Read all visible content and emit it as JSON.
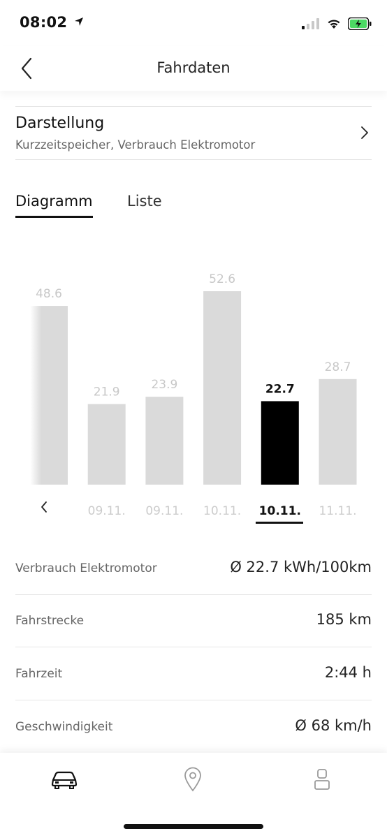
{
  "status_bar": {
    "time": "08:02",
    "icons": [
      "location-arrow-icon",
      "signal-icon",
      "wifi-icon",
      "battery-charging-icon"
    ]
  },
  "nav": {
    "title": "Fahrdaten",
    "back_icon": "chevron-left-icon"
  },
  "display_setting": {
    "title": "Darstellung",
    "subtitle": "Kurzzeitspeicher, Verbrauch Elektromotor",
    "chevron_icon": "chevron-right-icon"
  },
  "tabs": [
    {
      "label": "Diagramm",
      "active": true
    },
    {
      "label": "Liste",
      "active": false
    }
  ],
  "chart_data": {
    "type": "bar",
    "categories": [
      "",
      "09.11.",
      "09.11.",
      "10.11.",
      "10.11.",
      "11.11."
    ],
    "values": [
      48.6,
      21.9,
      23.9,
      52.6,
      22.7,
      28.7
    ],
    "value_labels": [
      "48.6",
      "21.9",
      "23.9",
      "52.6",
      "22.7",
      "28.7"
    ],
    "selected_index": 4,
    "ylim": [
      0,
      52.6
    ],
    "colors": {
      "bar": "#dadada",
      "selected_bar": "#000000",
      "label": "#c8c8c8",
      "selected_label": "#111111"
    }
  },
  "metrics": [
    {
      "label": "Verbrauch Elektromotor",
      "value": "Ø 22.7 kWh/100km"
    },
    {
      "label": "Fahrstrecke",
      "value": "185 km"
    },
    {
      "label": "Fahrzeit",
      "value": "2:44 h"
    },
    {
      "label": "Geschwindigkeit",
      "value": "Ø 68 km/h"
    }
  ],
  "tab_bar": [
    {
      "icon": "car-icon",
      "active": true
    },
    {
      "icon": "location-pin-icon",
      "active": false
    },
    {
      "icon": "user-icon",
      "active": false
    }
  ],
  "colors": {
    "accent": "#000000",
    "battery": "#4cd964",
    "muted": "#666666"
  }
}
